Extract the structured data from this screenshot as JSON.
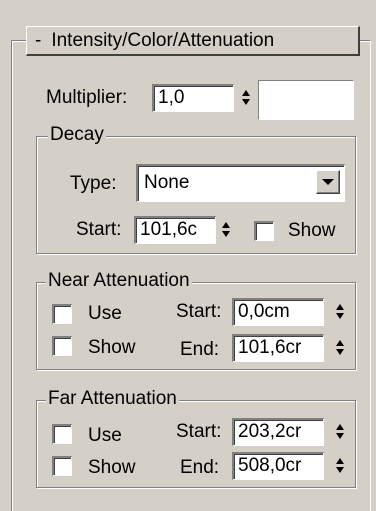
{
  "rollout": {
    "collapse_symbol": "-",
    "title": "Intensity/Color/Attenuation"
  },
  "multiplier": {
    "label": "Multiplier:",
    "value": "1,0",
    "color": "#ffffff"
  },
  "decay": {
    "title": "Decay",
    "type_label": "Type:",
    "type_value": "None",
    "start_label": "Start:",
    "start_value": "101,6c",
    "show_label": "Show"
  },
  "near_attenuation": {
    "title": "Near Attenuation",
    "use_label": "Use",
    "show_label": "Show",
    "start_label": "Start:",
    "start_value": "0,0cm",
    "end_label": "End:",
    "end_value": "101,6cr"
  },
  "far_attenuation": {
    "title": "Far Attenuation",
    "use_label": "Use",
    "show_label": "Show",
    "start_label": "Start:",
    "start_value": "203,2cr",
    "end_label": "End:",
    "end_value": "508,0cr"
  }
}
